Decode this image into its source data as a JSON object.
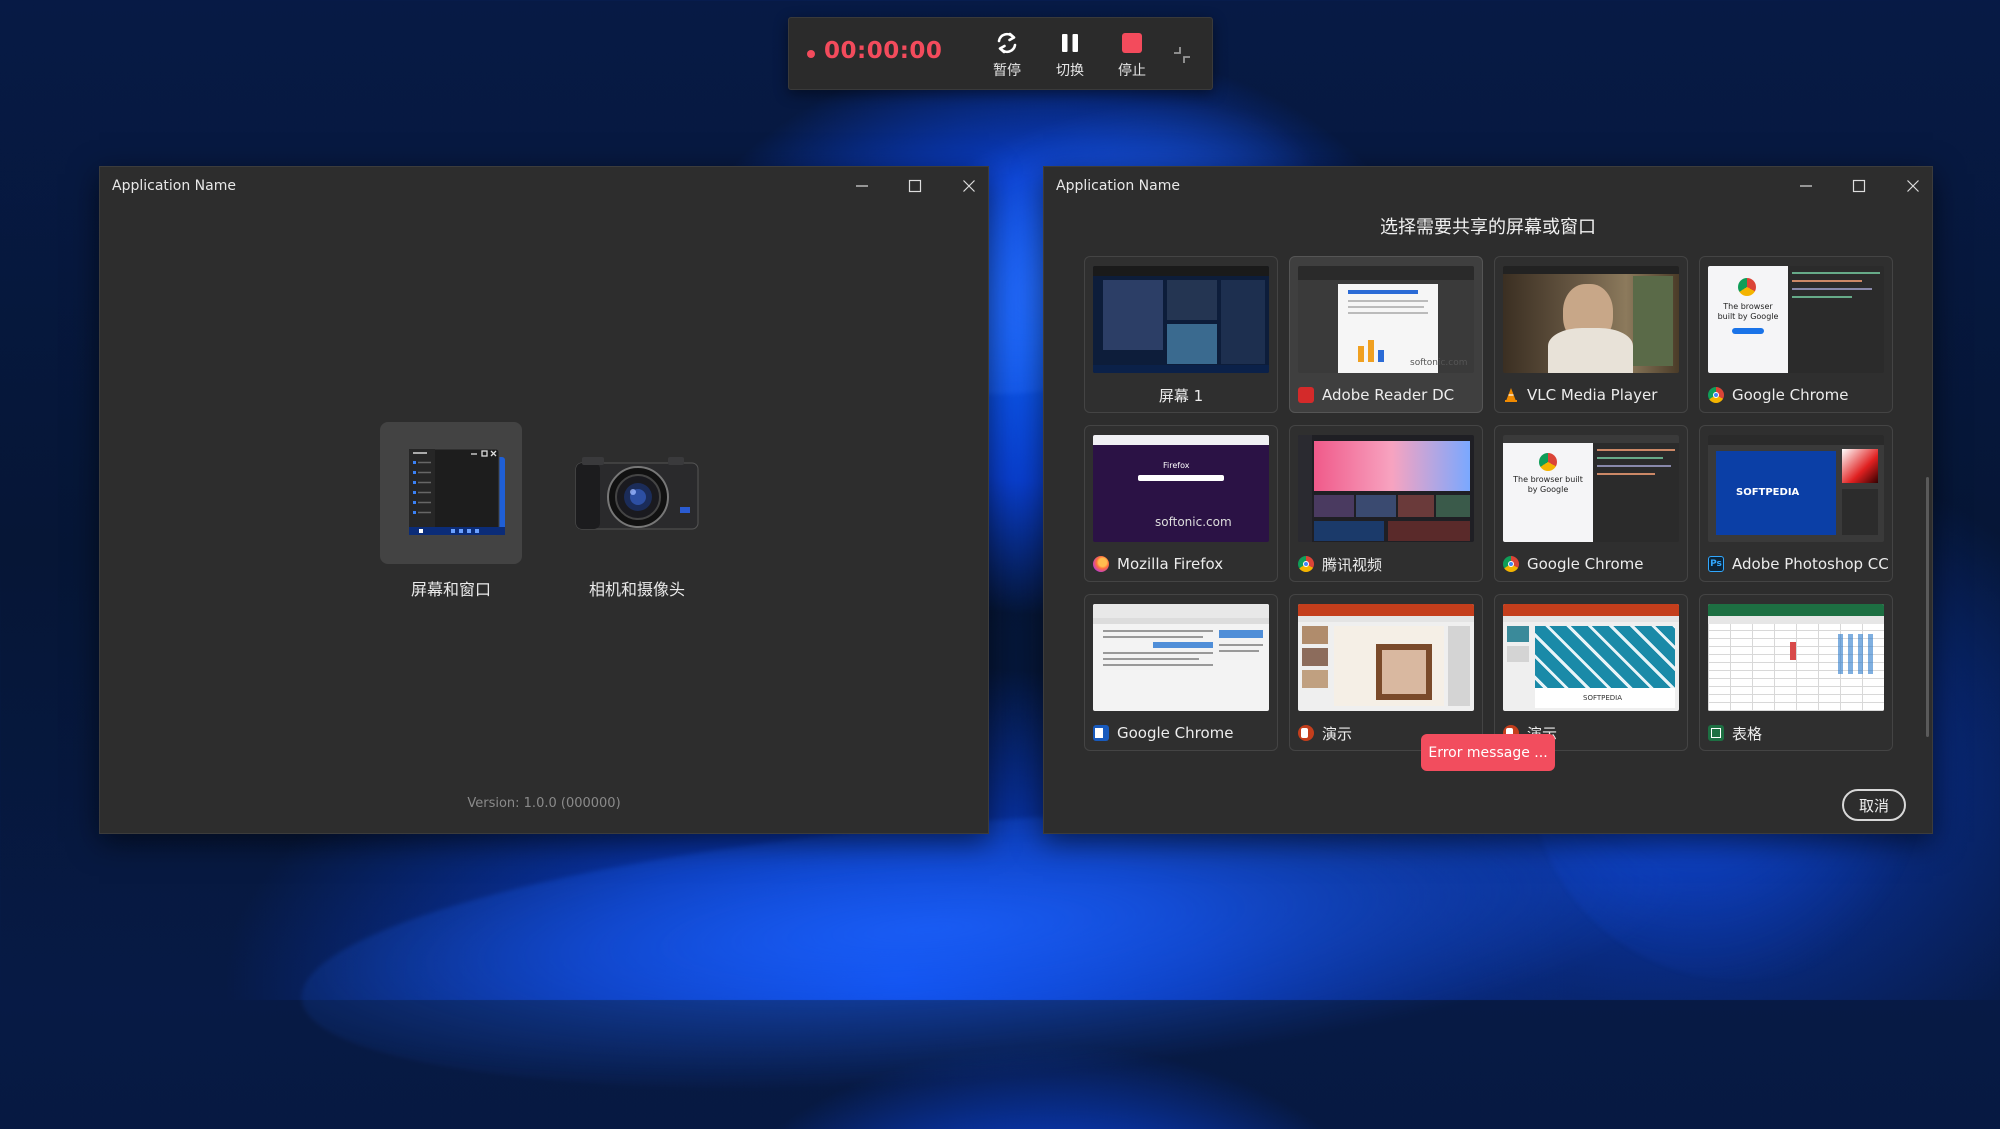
{
  "recorder": {
    "time": "00:00:00",
    "pause_label": "暂停",
    "switch_label": "切换",
    "stop_label": "停止",
    "accent": "#f34b5c"
  },
  "left_window": {
    "title": "Application Name",
    "options": [
      {
        "label": "屏幕和窗口",
        "icon": "screen-window-icon",
        "selected": true
      },
      {
        "label": "相机和摄像头",
        "icon": "camera-icon",
        "selected": false
      }
    ],
    "version": "Version: 1.0.0  (000000)"
  },
  "right_window": {
    "title": "Application Name",
    "heading": "选择需要共享的屏幕或窗口",
    "tiles": [
      {
        "label": "屏幕 1",
        "icon": "",
        "selected": false
      },
      {
        "label": "Adobe Reader DC",
        "icon": "adobe-reader-icon",
        "selected": true
      },
      {
        "label": "VLC Media Player",
        "icon": "vlc-icon",
        "selected": false
      },
      {
        "label": "Google Chrome",
        "icon": "chrome-icon",
        "selected": false
      },
      {
        "label": "Mozilla Firefox",
        "icon": "firefox-icon",
        "selected": false
      },
      {
        "label": "腾讯视频",
        "icon": "chrome-icon",
        "selected": false
      },
      {
        "label": "Google Chrome",
        "icon": "chrome-icon",
        "selected": false
      },
      {
        "label": "Adobe Photoshop CC",
        "icon": "photoshop-icon",
        "selected": false
      },
      {
        "label": "Google Chrome",
        "icon": "word-icon",
        "selected": false
      },
      {
        "label": "演示",
        "icon": "powerpoint-icon",
        "selected": false
      },
      {
        "label": "演示",
        "icon": "powerpoint-icon",
        "selected": false
      },
      {
        "label": "表格",
        "icon": "excel-icon",
        "selected": false
      }
    ],
    "thumb_texts": {
      "chrome_tagline": "The browser built by Google",
      "watermark": "softonic.com",
      "softpedia": "SOFTPEDIA",
      "firefox": "Firefox"
    },
    "toast": "Error message ...",
    "cancel_label": "取消"
  }
}
